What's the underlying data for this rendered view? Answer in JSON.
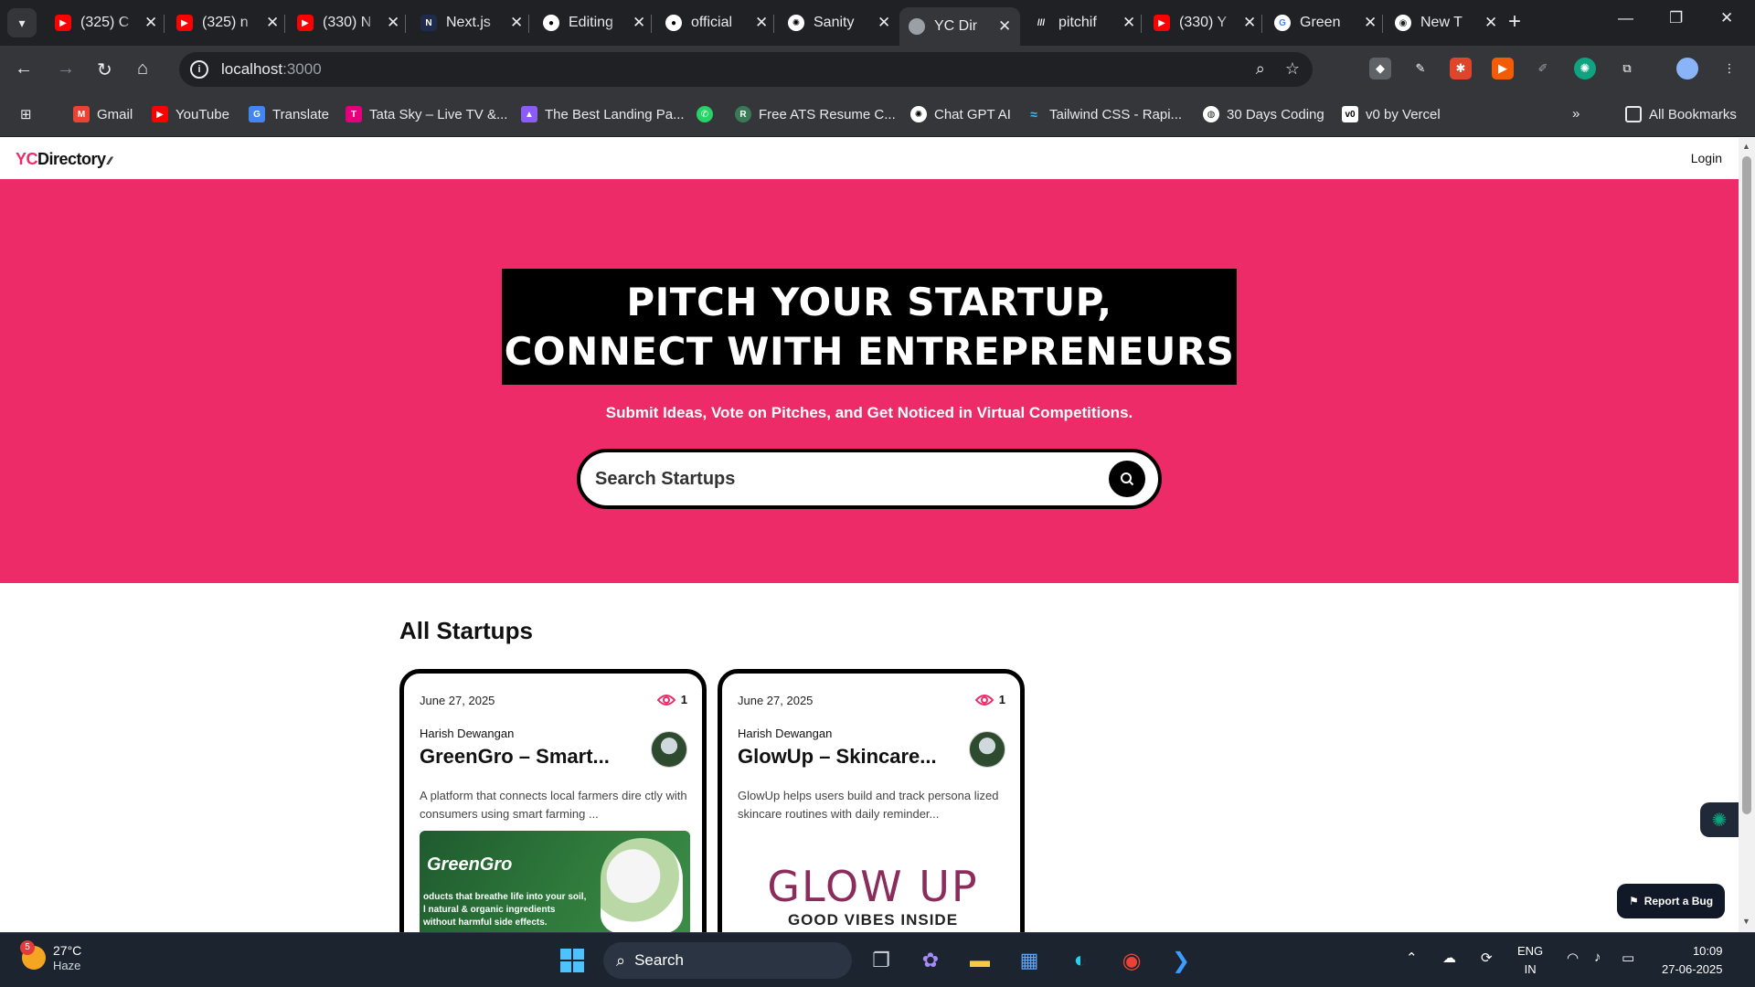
{
  "browser": {
    "tabs": [
      {
        "title": "(325) C",
        "favicon": "youtube-icon",
        "color": "#ff0000"
      },
      {
        "title": "(325) n",
        "favicon": "youtube-icon",
        "color": "#ff0000"
      },
      {
        "title": "(330) N",
        "favicon": "youtube-icon",
        "color": "#ff0000"
      },
      {
        "title": "Next.js",
        "favicon": "nextjs-icon",
        "color": "#1e2b4a"
      },
      {
        "title": "Editing",
        "favicon": "github-icon",
        "color": "#ffffff"
      },
      {
        "title": "official",
        "favicon": "github-icon",
        "color": "#ffffff"
      },
      {
        "title": "Sanity",
        "favicon": "chatgpt-icon",
        "color": "#ffffff"
      },
      {
        "title": "YC Dir",
        "favicon": "globe-icon",
        "color": "#9aa0a6",
        "active": true
      },
      {
        "title": "pitchif",
        "favicon": "stripes-icon",
        "color": "#ffffff"
      },
      {
        "title": "(330) Y",
        "favicon": "youtube-icon",
        "color": "#ff0000"
      },
      {
        "title": "Green",
        "favicon": "google-icon",
        "color": "#4285f4"
      },
      {
        "title": "New T",
        "favicon": "chrome-icon",
        "color": "#ffffff"
      }
    ],
    "url_host": "localhost",
    "url_port": ":3000",
    "bookmarks": [
      {
        "label": "Gmail",
        "icon": "gmail-icon",
        "color": "#ea4335"
      },
      {
        "label": "YouTube",
        "icon": "youtube-icon",
        "color": "#ff0000"
      },
      {
        "label": "Translate",
        "icon": "translate-icon",
        "color": "#4285f4"
      },
      {
        "label": "Tata Sky – Live TV &...",
        "icon": "tatasky-icon",
        "color": "#e4007c"
      },
      {
        "label": "The Best Landing Pa...",
        "icon": "landing-icon",
        "color": "#8b5cf6"
      },
      {
        "label": "",
        "icon": "whatsapp-icon",
        "color": "#25d366"
      },
      {
        "label": "Free ATS Resume C...",
        "icon": "resume-icon",
        "color": "#3b7a57"
      },
      {
        "label": "Chat GPT AI",
        "icon": "chatgpt-icon",
        "color": "#ffffff"
      },
      {
        "label": "Tailwind CSS - Rapi...",
        "icon": "tailwind-icon",
        "color": "#38bdf8"
      },
      {
        "label": "30 Days Coding",
        "icon": "globe-icon",
        "color": "#ffffff"
      },
      {
        "label": "v0 by Vercel",
        "icon": "v0-icon",
        "color": "#ffffff"
      }
    ],
    "all_bookmarks": "All Bookmarks"
  },
  "site": {
    "logo_yc": "YC",
    "logo_rest": "Directory",
    "login": "Login",
    "hero_line1": "PITCH YOUR STARTUP,",
    "hero_line2": "CONNECT WITH ENTREPRENEURS",
    "hero_sub": "Submit Ideas, Vote on Pitches, and Get Noticed in Virtual Competitions.",
    "search_placeholder": "Search Startups",
    "section_title": "All Startups",
    "accent": "#ee2b69",
    "cards": [
      {
        "date": "June 27, 2025",
        "views": "1",
        "author": "Harish Dewangan",
        "title": "GreenGro – Smart...",
        "desc": "A platform that connects local farmers dire ctly with consumers using smart farming ...",
        "img_logo": "GreenGro",
        "img_tag1": "oducts that breathe life into your soil,",
        "img_tag2": "l natural & organic ingredients",
        "img_tag3": "without harmful side effects."
      },
      {
        "date": "June 27, 2025",
        "views": "1",
        "author": "Harish Dewangan",
        "title": "GlowUp – Skincare...",
        "desc": "GlowUp helps users build and track persona lized skincare routines with daily reminder...",
        "img_main": "GLOW UP",
        "img_sub": "GOOD VIBES INSIDE"
      }
    ],
    "report_bug": "Report a Bug"
  },
  "taskbar": {
    "weather_badge": "5",
    "temp": "27°C",
    "condition": "Haze",
    "search": "Search",
    "lang1": "ENG",
    "lang2": "IN",
    "time": "10:09",
    "date": "27-06-2025"
  }
}
